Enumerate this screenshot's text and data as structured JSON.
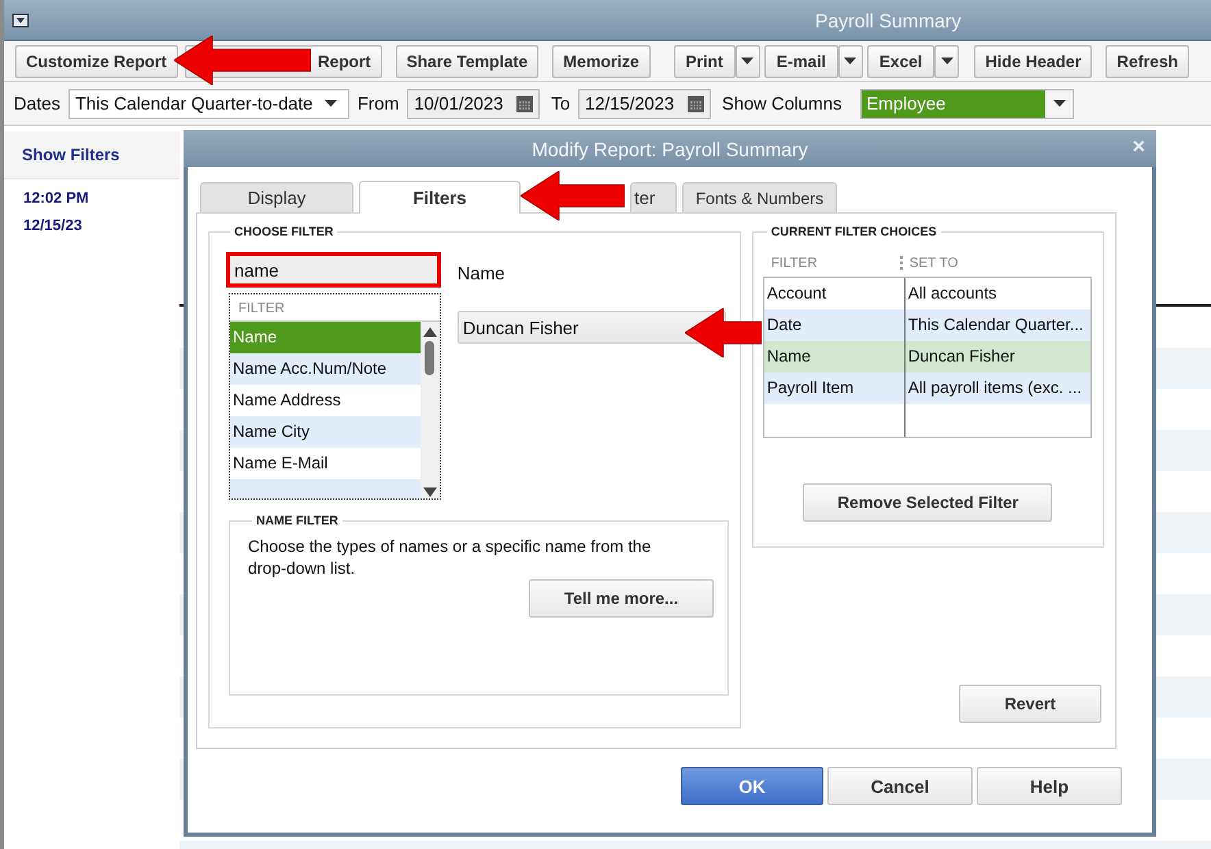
{
  "window": {
    "title": "Payroll Summary"
  },
  "toolbar": {
    "buttons": [
      {
        "label": "Customize Report",
        "kind": "plain"
      },
      {
        "label": "Report",
        "kind": "partial"
      },
      {
        "label": "Share Template",
        "kind": "plain"
      },
      {
        "label": "Memorize",
        "kind": "plain"
      },
      {
        "label": "Print",
        "kind": "split"
      },
      {
        "label": "E-mail",
        "kind": "split"
      },
      {
        "label": "Excel",
        "kind": "split"
      },
      {
        "label": "Hide Header",
        "kind": "plain"
      },
      {
        "label": "Refresh",
        "kind": "plain"
      }
    ]
  },
  "filters_bar": {
    "dates_label": "Dates",
    "dates_value": "This Calendar Quarter-to-date",
    "from_label": "From",
    "from_value": "10/01/2023",
    "to_label": "To",
    "to_value": "12/15/2023",
    "columns_label": "Show Columns",
    "columns_value": "Employee"
  },
  "report": {
    "show_filters": "Show Filters",
    "time": "12:02 PM",
    "date": "12/15/23"
  },
  "dialog": {
    "title": "Modify Report: Payroll Summary",
    "tabs": [
      {
        "label": "Display",
        "selected": false
      },
      {
        "label": "Filters",
        "selected": true
      },
      {
        "label": "ter",
        "selected": false
      },
      {
        "label": "Fonts & Numbers",
        "selected": false
      }
    ],
    "choose_filter": {
      "heading": "CHOOSE FILTER",
      "search_value": "name",
      "list_heading": "FILTER",
      "items": [
        {
          "label": "Name",
          "selected": true
        },
        {
          "label": "Name Acc.Num/Note",
          "selected": false
        },
        {
          "label": "Name Address",
          "selected": false
        },
        {
          "label": "Name City",
          "selected": false
        },
        {
          "label": "Name E-Mail",
          "selected": false
        }
      ],
      "field_label": "Name",
      "field_value": "Duncan Fisher"
    },
    "name_filter": {
      "heading": "NAME FILTER",
      "text": "Choose the types of names or a specific name from the drop-down list.",
      "button": "Tell me more..."
    },
    "current": {
      "heading": "CURRENT FILTER CHOICES",
      "columns": [
        "FILTER",
        "SET TO"
      ],
      "rows": [
        {
          "filter": "Account",
          "set_to": "All accounts",
          "selected": false
        },
        {
          "filter": "Date",
          "set_to": "This Calendar Quarter...",
          "selected": false
        },
        {
          "filter": "Name",
          "set_to": "Duncan Fisher",
          "selected": true
        },
        {
          "filter": "Payroll Item",
          "set_to": "All payroll items (exc. ...",
          "selected": false
        }
      ],
      "button": "Remove Selected Filter"
    },
    "revert": "Revert",
    "close": "×",
    "buttons": [
      {
        "label": "OK",
        "kind": "primary"
      },
      {
        "label": "Cancel",
        "kind": "plain"
      },
      {
        "label": "Help",
        "kind": "plain"
      }
    ]
  }
}
